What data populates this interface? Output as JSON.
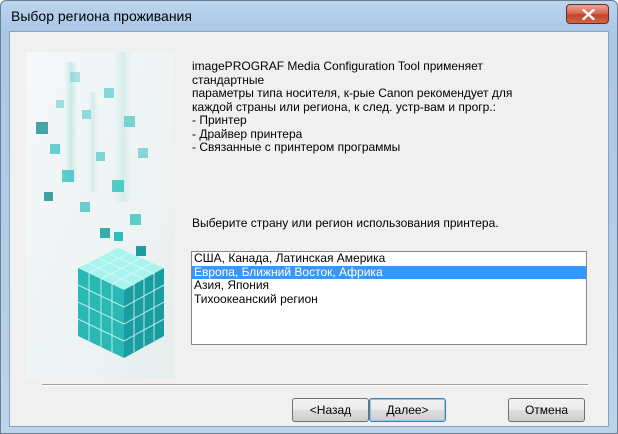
{
  "window": {
    "title": "Выбор региона проживания",
    "close_icon": "close-icon"
  },
  "description": {
    "lines": [
      "imagePROGRAF Media Configuration Tool применяет",
      "стандартные",
      "параметры типа носителя, к-рые Canon рекомендует для",
      "каждой страны или региона, к след. устр-вам и прогр.:",
      "- Принтер",
      "- Драйвер принтера",
      "- Связанные с принтером программы"
    ]
  },
  "prompt": "Выберите страну или регион использования принтера.",
  "region_list": {
    "items": [
      "США, Канада, Латинская Америка",
      "Европа, Ближний Восток, Африка",
      "Азия, Япония",
      "Тихоокеанский регион"
    ],
    "selected_index": 1
  },
  "buttons": {
    "back": "<Назад",
    "next": "Далее>",
    "cancel": "Отмена"
  },
  "colors": {
    "selection": "#3399ff",
    "accent_cubes": "#22b8b8",
    "close_button": "#c1442c"
  }
}
